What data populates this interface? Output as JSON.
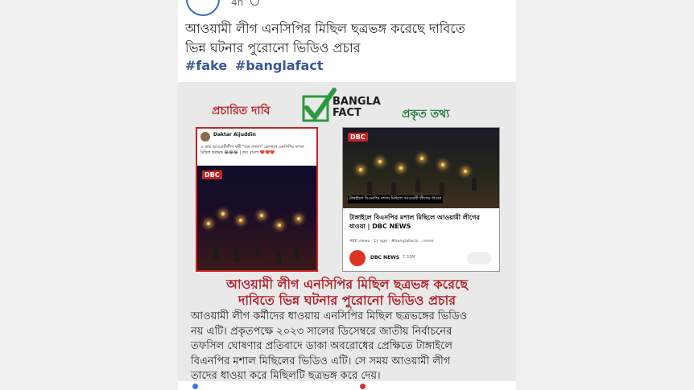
{
  "post": {
    "time": "4h",
    "caption_lines": [
      "আওয়ামী লীগ এনসিপির মিছিল ছত্রভঙ্গ করেছে দাবিতে",
      "ভিন্ন ঘটনার পুরোনো ভিডিও প্রচার"
    ],
    "hashtags": [
      "#fake",
      "#banglafact"
    ]
  },
  "image": {
    "label_claim": "প্রচারিত দাবি",
    "label_fact": "প্রকৃত তথ্য",
    "logo": {
      "line1": "BANGLA",
      "line2": "FACT"
    },
    "left_card": {
      "author": "Daktar Aijuddin",
      "text": "এ কার আওয়ামীলীগ কর্মী \"জয় বাংলা\" স্লোগানে এনসিপির মশাল মিছিল ছত্রভঙ্গ 😂😂😂 | জয় বাংলা ❤️❤️❤️",
      "channel_badge": "DBC"
    },
    "right_card": {
      "channel_badge": "DBC",
      "subtitle": "টাঙ্গাইলে বিএনপির মশাল মিছিলে আওয়ামী লীগের ধাওয়া",
      "title": "টাঙ্গাইলে বিএনপির মশাল মিছিলে আওয়ামী লীগের ধাওয়া | DBC NEWS",
      "meta": "48K views · 1y ago · #banglafacts ...more",
      "channel_name": "DBC NEWS",
      "subscribers": "7.32M"
    },
    "headline_lines": [
      "আওয়ামী লীগ এনসিপির মিছিল ছত্রভঙ্গ করেছে",
      "দাবিতে ভিন্ন ঘটনার পুরোনো ভিডিও প্রচার"
    ],
    "body_lines": [
      "আওয়ামী লীগ কর্মীদের ধাওয়ায় এনসিপির মিছিল ছত্রভঙ্গের ভিডিও",
      "নয় এটি। প্রকৃতপক্ষে ২০২৩ সালের ডিসেম্বরে জাতীয় নির্বাচনের",
      "তফসিল ঘোষণার প্রতিবাদে ডাকা অবরোধের প্রেক্ষিতে টাঙ্গাইলে",
      "বিএনপির মশাল মিছিলের ভিডিও এটি। সে সময় আওয়ামী লীগ",
      "তাদের ধাওয়া করে মিছিলটি ছত্রভঙ্গ করে দেয়।"
    ]
  }
}
